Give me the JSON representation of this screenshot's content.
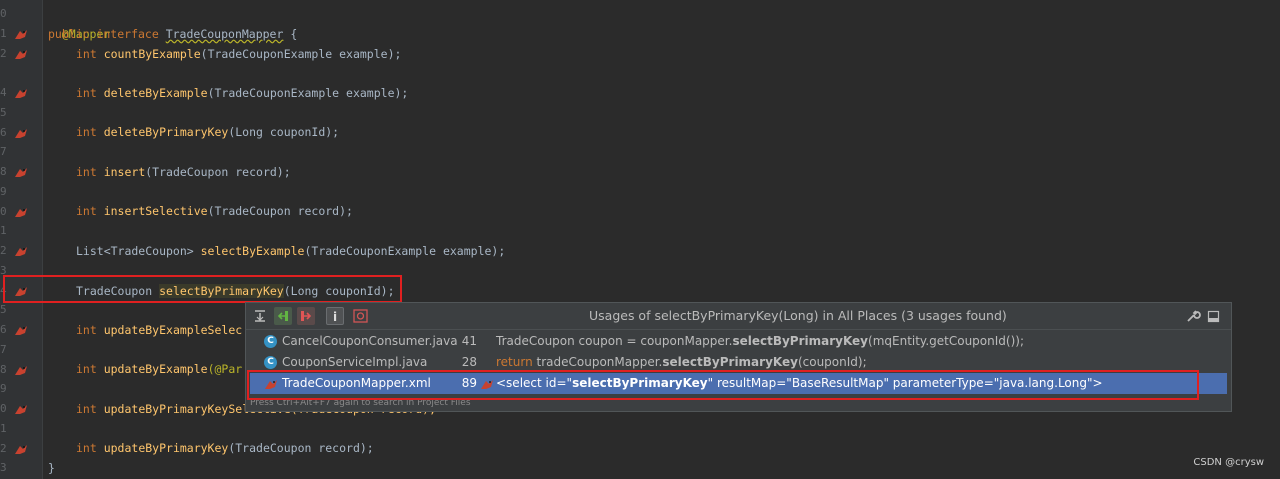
{
  "editor": {
    "line_numbers": [
      "0",
      "1",
      "2",
      "",
      "4",
      "5",
      "6",
      "7",
      "8",
      "9",
      "0",
      "1",
      "2",
      "3",
      "4",
      "5",
      "6",
      "7",
      "8",
      "9",
      "0",
      "1",
      "2",
      "3"
    ],
    "lines": {
      "l0": "@Mapper",
      "l1_kw": "public interface ",
      "l1_name": "TradeCouponMapper",
      "l1_rest": " {",
      "l2_kw": "int ",
      "l2_fn": "countByExample",
      "l2_rest": "(TradeCouponExample example);",
      "l4_kw": "int ",
      "l4_fn": "deleteByExample",
      "l4_rest": "(TradeCouponExample example);",
      "l6_kw": "int ",
      "l6_fn": "deleteByPrimaryKey",
      "l6_rest": "(Long couponId);",
      "l8_kw": "int ",
      "l8_fn": "insert",
      "l8_rest": "(TradeCoupon record);",
      "l10_kw": "int ",
      "l10_fn": "insertSelective",
      "l10_rest": "(TradeCoupon record);",
      "l12_type": "List<TradeCoupon> ",
      "l12_fn": "selectByExample",
      "l12_rest": "(TradeCouponExample example);",
      "l14_type": "TradeCoupon ",
      "l14_fn": "selectByPrimaryKey",
      "l14_rest": "(Long couponId);",
      "l16_kw": "int ",
      "l16_fn": "updateByExampleSelec",
      "l18_kw": "int ",
      "l18_fn": "updateByExample",
      "l18_rest": "(@Par",
      "l20_kw": "int ",
      "l20_fn": "updateByPrimaryKeySe",
      "l20_rest": "lective(TradeCoupon record);",
      "l22_kw": "int ",
      "l22_fn": "updateByPrimaryKey",
      "l22_rest": "(TradeCoupon record);",
      "l23": "}"
    }
  },
  "popup": {
    "title": "Usages of selectByPrimaryKey(Long) in All Places (3 usages found)",
    "toolbar_icons": [
      "merge-icon",
      "previous-occurrence-icon",
      "next-occurrence-icon",
      "info-icon",
      "filter-icon"
    ],
    "rows": [
      {
        "file": "CancelCouponConsumer.java",
        "line": "41",
        "pre": "TradeCoupon coupon = couponMapper.",
        "bold": "selectByPrimaryKey",
        "post": "(mqEntity.getCouponId());"
      },
      {
        "file": "CouponServiceImpl.java",
        "line": "28",
        "ret": "return ",
        "pre": "tradeCouponMapper.",
        "bold": "selectByPrimaryKey",
        "post": "(couponId);"
      },
      {
        "file": "TradeCouponMapper.xml",
        "line": "89",
        "pre": "<select id=\"",
        "bold": "selectByPrimaryKey",
        "post": "\" resultMap=\"BaseResultMap\" parameterType=\"java.lang.Long\">"
      }
    ],
    "hint": "Press Ctrl+Alt+F7 again to search in Project Files"
  },
  "watermark": "CSDN @crysw",
  "colors": {
    "keyword": "#cc7832",
    "function": "#ffc66d",
    "annotation": "#bbb529",
    "selection": "#4b6eaf",
    "highlight_box": "#e02020"
  }
}
